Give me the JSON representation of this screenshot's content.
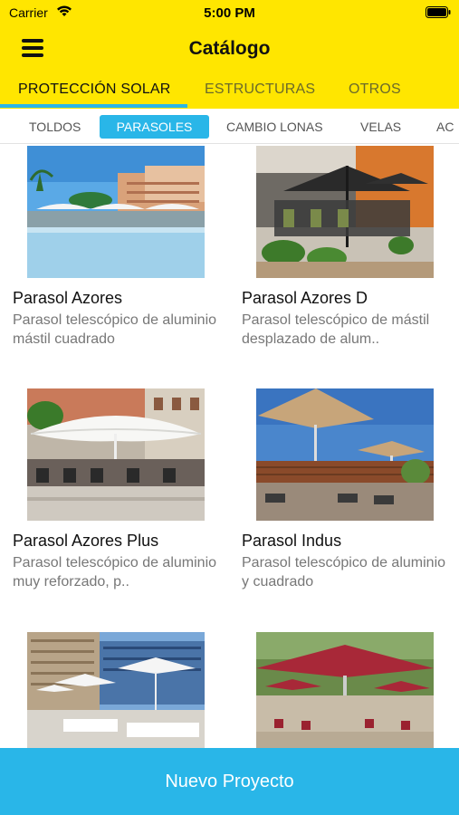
{
  "status_bar": {
    "carrier": "Carrier",
    "time": "5:00 PM"
  },
  "header": {
    "title": "Catálogo"
  },
  "main_tabs": [
    {
      "label": "PROTECCIÓN SOLAR",
      "active": true
    },
    {
      "label": "ESTRUCTURAS",
      "active": false
    },
    {
      "label": "OTROS",
      "active": false
    }
  ],
  "sub_tabs": [
    {
      "label": "TOLDOS",
      "active": false
    },
    {
      "label": "PARASOLES",
      "active": true
    },
    {
      "label": "CAMBIO LONAS",
      "active": false
    },
    {
      "label": "VELAS",
      "active": false
    },
    {
      "label": "AC",
      "active": false
    }
  ],
  "products": [
    {
      "name": "Parasol Azores",
      "description": "Parasol telescópico de aluminio mástil cuadrado"
    },
    {
      "name": "Parasol Azores D",
      "description": "Parasol telescópico de mástil desplazado de alum.."
    },
    {
      "name": "Parasol Azores Plus",
      "description": "Parasol telescópico de aluminio muy reforzado, p.."
    },
    {
      "name": "Parasol Indus",
      "description": "Parasol telescópico de aluminio y cuadrado"
    },
    {
      "name": "",
      "description": ""
    },
    {
      "name": "",
      "description": ""
    }
  ],
  "bottom_button": {
    "label": "Nuevo Proyecto"
  },
  "colors": {
    "header_yellow": "#FFE600",
    "accent_blue": "#29B6E8"
  }
}
